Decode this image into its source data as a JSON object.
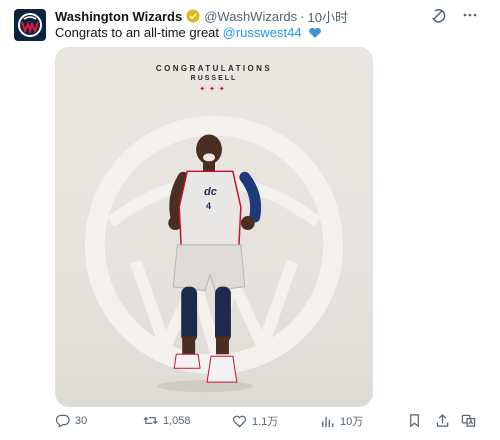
{
  "tweet": {
    "display_name": "Washington Wizards",
    "handle": "@WashWizards",
    "separator": "·",
    "time": "10小时",
    "text_prefix": "Congrats to an all-time great ",
    "mention": "@russwest44",
    "verified_icon": "verified-badge-icon",
    "heart_emoji": "blue-heart-icon"
  },
  "header_actions": [
    "grok-icon",
    "more-icon"
  ],
  "media": {
    "title_line1": "CONGRATULATIONS",
    "title_line2": "RUSSELL",
    "stars": "✦✦✦",
    "jersey_text": "dc",
    "jersey_number": "4"
  },
  "actions": {
    "replies": "30",
    "retweets": "1,058",
    "likes": "1.1万",
    "views": "10万"
  },
  "colors": {
    "accent": "#1d9bf0",
    "navy": "#0c2340",
    "red": "#c8102e",
    "muted": "#536471"
  }
}
